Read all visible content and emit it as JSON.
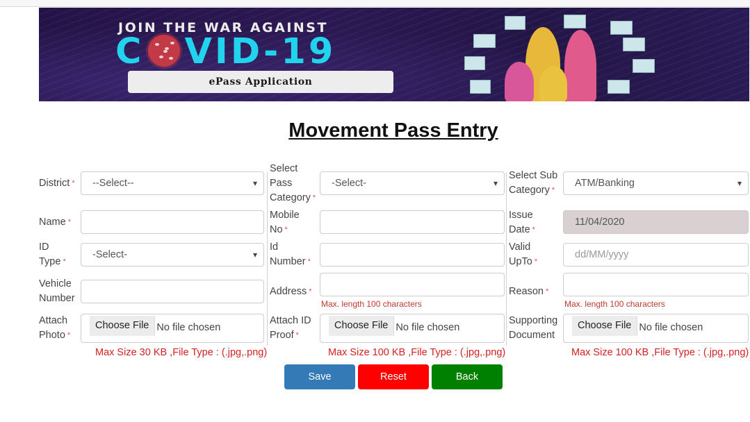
{
  "banner": {
    "line1": "JOIN THE WAR AGAINST",
    "covid_c": "C",
    "covid_rest": "VID-19",
    "subtitle": "ePass Application",
    "virus_icon": "coronavirus-icon",
    "illustration": "family-illustration"
  },
  "page_title": "Movement Pass Entry",
  "form": {
    "district": {
      "label": "District",
      "required": "*",
      "value": "--Select--"
    },
    "pass_category": {
      "label_lines": [
        "Select",
        "Pass",
        "Category"
      ],
      "required": "*",
      "value": "-Select-"
    },
    "sub_category": {
      "label_lines": [
        "Select Sub",
        "Category"
      ],
      "required": "*",
      "value": "ATM/Banking"
    },
    "name": {
      "label": "Name",
      "required": "*",
      "value": ""
    },
    "mobile": {
      "label_lines": [
        "Mobile",
        "No"
      ],
      "required": "*",
      "value": ""
    },
    "issue_date": {
      "label_lines": [
        "Issue",
        "Date"
      ],
      "required": "*",
      "value": "11/04/2020"
    },
    "id_type": {
      "label_lines": [
        "ID",
        "Type"
      ],
      "required": "*",
      "value": "-Select-"
    },
    "id_number": {
      "label_lines": [
        "Id",
        "Number"
      ],
      "required": "*",
      "value": ""
    },
    "valid_upto": {
      "label_lines": [
        "Valid",
        "UpTo"
      ],
      "required": "*",
      "placeholder": "dd/MM/yyyy"
    },
    "vehicle_number": {
      "label_lines": [
        "Vehicle",
        "Number"
      ],
      "value": ""
    },
    "address": {
      "label": "Address",
      "required": "*",
      "value": "",
      "hint": "Max. length 100 characters"
    },
    "reason": {
      "label": "Reason",
      "required": "*",
      "value": "",
      "hint": "Max. length 100 characters"
    },
    "attach_photo": {
      "label_lines": [
        "Attach",
        "Photo"
      ],
      "required": "*",
      "button": "Choose File",
      "file_status": "No file chosen",
      "hint": "Max Size 30 KB ,File Type : (.jpg,.png)"
    },
    "attach_id_proof": {
      "label_lines": [
        "Attach ID",
        "Proof"
      ],
      "required": "*",
      "button": "Choose File",
      "file_status": "No file chosen",
      "hint": "Max Size 100 KB ,File Type : (.jpg,.png)"
    },
    "supporting_document": {
      "label_lines": [
        "Supporting",
        "Document"
      ],
      "button": "Choose File",
      "file_status": "No file chosen",
      "hint": "Max Size 100 KB ,File Type : (.jpg,.png)"
    }
  },
  "buttons": {
    "save": {
      "label": "Save",
      "color": "#337ab7"
    },
    "reset": {
      "label": "Reset",
      "color": "#ff0000"
    },
    "back": {
      "label": "Back",
      "color": "#008000"
    }
  },
  "colors": {
    "required_mark": "#d9534f",
    "hint_text": "#d42020",
    "banner_bg": "#241347",
    "covid_text": "#22d3ee"
  }
}
